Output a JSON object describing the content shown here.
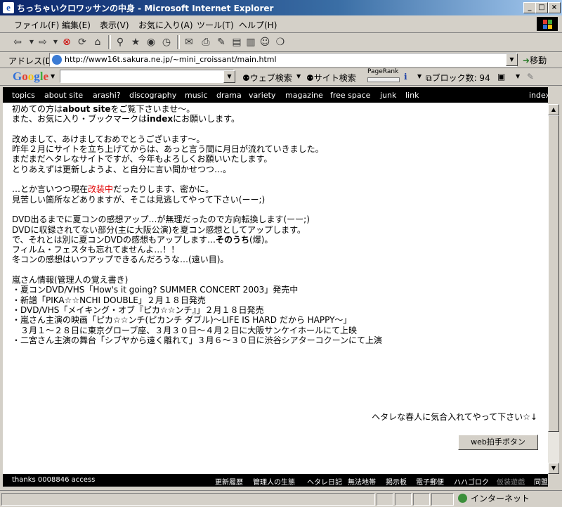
{
  "window": {
    "title": "ちっちゃいクロワッサンの中身 - Microsoft Internet Explorer"
  },
  "menu": [
    "ファイル(F)",
    "編集(E)",
    "表示(V)",
    "お気に入り(A)",
    "ツール(T)",
    "ヘルプ(H)"
  ],
  "address": {
    "label": "アドレス(D)",
    "url": "http://www16t.sakura.ne.jp/~mini_croissant/main.html",
    "go_label": "移動"
  },
  "googlebar": {
    "logo": "Google",
    "web_search": "ウェブ検索",
    "site_search": "サイト検索",
    "pagerank": "PageRank",
    "block_count": "ブロック数: 94"
  },
  "nav": [
    "topics",
    "about site",
    "arashi?",
    "discography",
    "music",
    "drama",
    "variety",
    "magazine",
    "free space",
    "junk",
    "link",
    "index"
  ],
  "content": {
    "line1": {
      "a": "初めての方は",
      "b": "about site",
      "c": "をご覧下さいませ～。"
    },
    "line2": {
      "a": "また、お気に入り・ブックマークは",
      "b": "index",
      "c": "にお願いします。"
    },
    "p2": [
      "改めまして、あけましておめでとうございます～。",
      "昨年２月にサイトを立ち上げてからは、あっと言う間に月日が流れていきました。",
      "まだまだヘタレなサイトですが、今年もよろしくお願いいたします。",
      "とりあえずは更新しようよ、と自分に言い聞かせつつ…。"
    ],
    "p3a": {
      "a": "…とか言いつつ現在",
      "b": "改装中",
      "c": "だったりします、密かに。"
    },
    "p3b": "見苦しい箇所などありますが、そこは見逃してやって下さい(ーー;)",
    "p4": [
      "DVD出るまでに夏コンの感想アップ…が無理だったので方向転換します(ーー;)",
      "DVDに収録されてない部分(主に大阪公演)を夏コン感想としてアップします。"
    ],
    "p4c": {
      "a": "で、それとは別に夏コンDVDの感想もアップします…",
      "b": "そのうち",
      "c": "(爆)。"
    },
    "p4d": [
      "フィルム・フェスタも忘れてませんよ…！！",
      "冬コンの感想はいつアップできるんだろうな…(遠い目)。"
    ],
    "p5": [
      "嵐さん情報(管理人の覚え書き)",
      "・夏コンDVD/VHS「How's it going?  SUMMER  CONCERT  2003」発売中",
      "・新譜「PIKA☆☆NCHI  DOUBLE」２月１８日発売",
      "・DVD/VHS「メイキング・オブ『ピカ☆☆ンチ』」２月１８日発売",
      "・嵐さん主演の映画「ピカ☆☆ンチ(ピカンチ ダブル)～LIFE IS HARD だから HAPPY～」",
      "　３月１～２８日に東京グローブ座、３月３０日～４月２日に大阪サンケイホールにて上映",
      "・二宮さん主演の舞台「シブヤから遠く離れて」３月６～３０日に渋谷シアターコクーンにて上演"
    ]
  },
  "message": "ヘタレな春人に気合入れてやって下さい☆↓",
  "web_button": "web拍手ボタン",
  "footer": {
    "access": "thanks 0008846 access",
    "links": [
      "更新履歴",
      "管理人の生態",
      "ヘタレ日記",
      "無法地帯",
      "掲示板",
      "電子郵便",
      "ハハゴロク",
      "仮装遊戯",
      "同盟"
    ]
  },
  "status": {
    "zone": "インターネット"
  }
}
